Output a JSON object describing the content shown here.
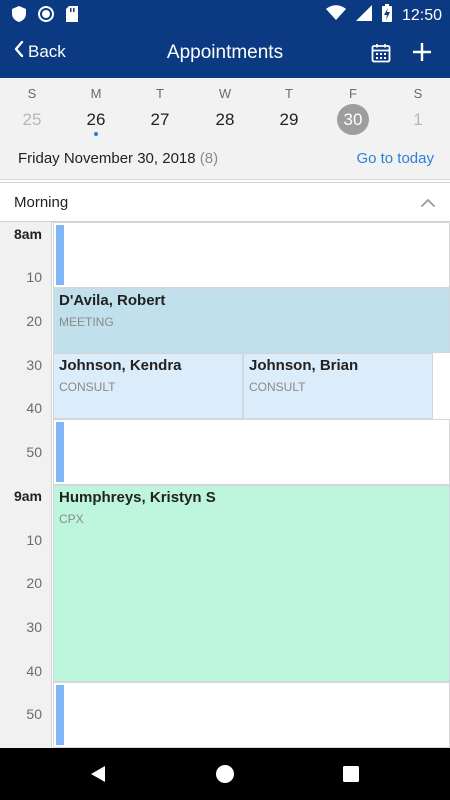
{
  "status_bar": {
    "time": "12:50",
    "icons": [
      "shield-icon",
      "circle-record-icon",
      "sd-card-icon",
      "wifi-icon",
      "cell-signal-icon",
      "battery-charging-icon"
    ]
  },
  "app_bar": {
    "back_label": "Back",
    "title": "Appointments",
    "icons": [
      "calendar-icon",
      "add-icon"
    ]
  },
  "week": {
    "days": [
      {
        "dow": "S",
        "date": "25",
        "state": "muted"
      },
      {
        "dow": "M",
        "date": "26",
        "state": "has-events"
      },
      {
        "dow": "T",
        "date": "27",
        "state": "normal"
      },
      {
        "dow": "W",
        "date": "28",
        "state": "normal"
      },
      {
        "dow": "T",
        "date": "29",
        "state": "normal"
      },
      {
        "dow": "F",
        "date": "30",
        "state": "selected"
      },
      {
        "dow": "S",
        "date": "1",
        "state": "muted"
      }
    ],
    "selected_date_label": "Friday November 30, 2018",
    "selected_count": "(8)",
    "goto_today_label": "Go to today"
  },
  "section": {
    "label": "Morning",
    "state": "expanded"
  },
  "time_labels": [
    "8am",
    "10",
    "20",
    "30",
    "40",
    "50",
    "9am",
    "10",
    "20",
    "30",
    "40",
    "50"
  ],
  "appointments": [
    {
      "name": "D'Avila, Robert",
      "type": "MEETING",
      "color": "#c0e0ec"
    },
    {
      "name": "Johnson, Kendra",
      "type": "CONSULT",
      "color": "#dbecfb"
    },
    {
      "name": "Johnson, Brian",
      "type": "CONSULT",
      "color": "#dbecfb"
    },
    {
      "name": "Humphreys, Kristyn S",
      "type": "CPX",
      "color": "#bdf6dd"
    }
  ],
  "colors": {
    "header_bg": "#0b3a83",
    "accent_link": "#2f7fd6",
    "open_slot_marker": "#7fb6f5"
  }
}
